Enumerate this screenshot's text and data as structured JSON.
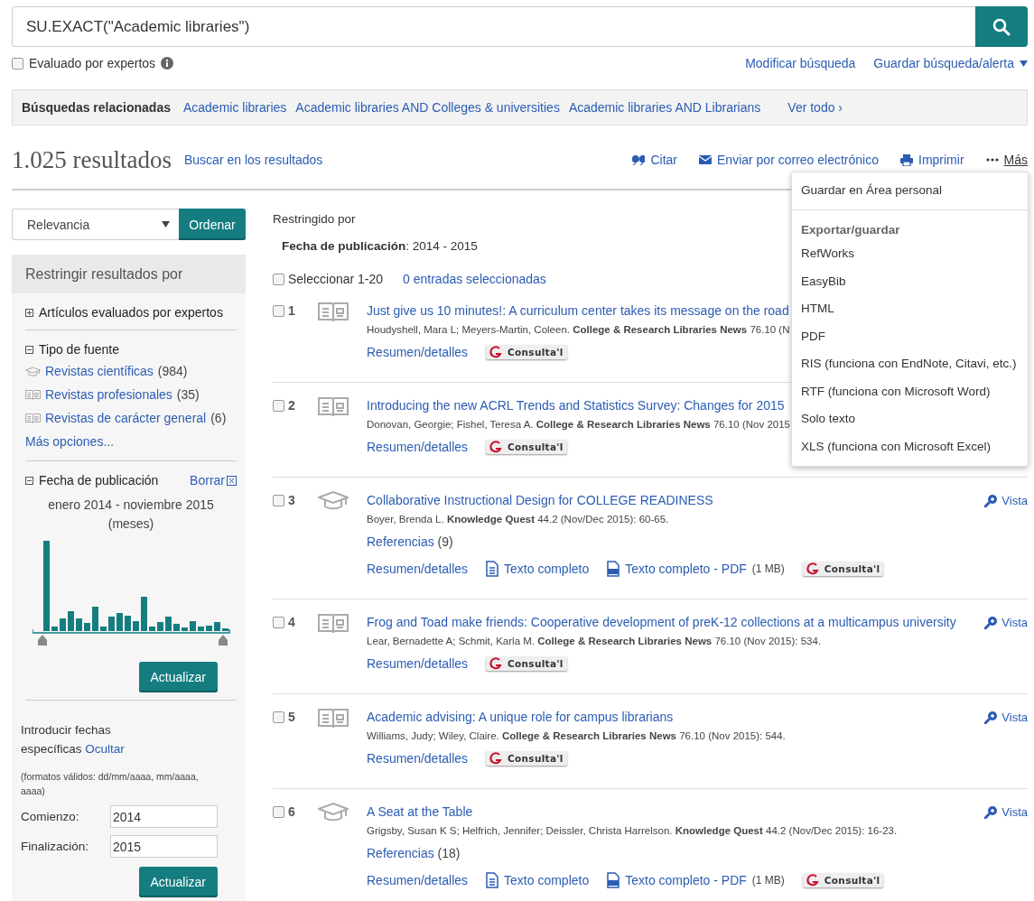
{
  "search": {
    "query": "SU.EXACT(\"Academic libraries\")",
    "peer_reviewed": {
      "label": "Evaluado por expertos",
      "checked": false
    },
    "links": [
      {
        "kind": "plain",
        "label": "Modificar búsqueda"
      },
      {
        "kind": "dropdown",
        "label": "Guardar búsqueda/alerta"
      }
    ]
  },
  "related": {
    "label": "Búsquedas relacionadas",
    "items": [
      "Academic libraries",
      "Academic libraries AND Colleges & universities",
      "Academic libraries AND Librarians"
    ],
    "see_all": "Ver todo ›"
  },
  "results_header": {
    "count": "1.025 resultados",
    "search_within": "Buscar en los resultados",
    "actions": [
      {
        "kind": "cite",
        "label": "Citar"
      },
      {
        "kind": "email",
        "label": "Enviar por correo electrónico"
      },
      {
        "kind": "print",
        "label": "Imprimir"
      },
      {
        "kind": "more",
        "label": "Más"
      }
    ]
  },
  "sort": {
    "value": "Relevancia",
    "button": "Ordenar"
  },
  "refine": {
    "title": "Restringir resultados por",
    "sections": [
      {
        "label": "Artículos evaluados por expertos",
        "expanded": false
      },
      {
        "label": "Tipo de fuente",
        "expanded": true,
        "items": [
          {
            "kind": "scholarly",
            "label": "Revistas científicas",
            "count": "(984)"
          },
          {
            "kind": "magazine",
            "label": "Revistas profesionales",
            "count": "(35)"
          },
          {
            "kind": "magazine",
            "label": "Revistas de carácter general",
            "count": "(6)"
          }
        ],
        "more": "Más opciones..."
      },
      {
        "label": "Fecha de publicación",
        "expanded": true,
        "clear": "Borrar"
      }
    ],
    "date_range": "enero 2014 - noviembre 2015",
    "unit": "(meses)",
    "update": "Actualizar",
    "specific": {
      "text": "Introducir fechas específicas",
      "toggle": "Ocultar",
      "formats": "(formatos válidos: dd/mm/aaaa, mm/aaaa, aaaa)",
      "fields": [
        {
          "label": "Comienzo:",
          "value": "2014"
        },
        {
          "label": "Finalización:",
          "value": "2015"
        }
      ],
      "update": "Actualizar"
    }
  },
  "limits": {
    "label": "Restringido por",
    "items": [
      "**Fecha de publicación**: 2014 - 2015"
    ]
  },
  "select": {
    "label": "Seleccionar 1-20",
    "checked": false,
    "selected_count": "0 entradas seleccionadas"
  },
  "results": [
    {
      "number": "1",
      "kind": "magazine",
      "checked": false,
      "title": "Just give us 10 minutes!: A curriculum center takes its message on the road",
      "citation": "Houdyshell, Mara L; Meyers-Martin, Coleen. **College & Research Libraries News** 76.10  (N",
      "links": [
        {
          "kind": "abstract",
          "label": "Resumen/detalles"
        },
        {
          "kind": "badge",
          "label": "Consulta'l"
        }
      ]
    },
    {
      "number": "2",
      "kind": "magazine",
      "checked": false,
      "title": "Introducing the new ACRL Trends and Statistics Survey: Changes for 2015",
      "citation": "Donovan, Georgie; Fishel, Teresa A. **College & Research Libraries News** 76.10  (Nov 2015",
      "links": [
        {
          "kind": "abstract",
          "label": "Resumen/detalles"
        },
        {
          "kind": "badge",
          "label": "Consulta'l"
        }
      ]
    },
    {
      "number": "3",
      "kind": "scholarly",
      "checked": false,
      "title": "Collaborative Instructional Design for COLLEGE READINESS",
      "citation": "Boyer, Brenda L. **Knowledge Quest** 44.2  (Nov/Dec 2015): 60-65.",
      "references": {
        "label": "Referencias",
        "count": "(9)"
      },
      "links": [
        {
          "kind": "abstract",
          "label": "Resumen/detalles"
        },
        {
          "kind": "fulltext",
          "label": "Texto completo"
        },
        {
          "kind": "pdf",
          "label": "Texto completo - PDF",
          "size": "(1 MB)"
        },
        {
          "kind": "badge",
          "label": "Consulta'l"
        }
      ],
      "preview": "Vista"
    },
    {
      "number": "4",
      "kind": "magazine",
      "checked": false,
      "title": "Frog and Toad make friends: Cooperative development of preK-12 collections at a multicampus university",
      "citation": "Lear, Bernadette A; Schmit, Karla M. **College & Research Libraries News** 76.10  (Nov 2015): 534.",
      "links": [
        {
          "kind": "abstract",
          "label": "Resumen/detalles"
        },
        {
          "kind": "badge",
          "label": "Consulta'l"
        }
      ],
      "preview": "Vista"
    },
    {
      "number": "5",
      "kind": "magazine",
      "checked": false,
      "title": "Academic advising: A unique role for campus librarians",
      "citation": "Williams, Judy; Wiley, Claire. **College & Research Libraries News** 76.10  (Nov 2015): 544.",
      "links": [
        {
          "kind": "abstract",
          "label": "Resumen/detalles"
        },
        {
          "kind": "badge",
          "label": "Consulta'l"
        }
      ],
      "preview": "Vista"
    },
    {
      "number": "6",
      "kind": "scholarly",
      "checked": false,
      "title": "A Seat at the Table",
      "citation": "Grigsby, Susan K S; Helfrich, Jennifer; Deissler, Christa Harrelson. **Knowledge Quest** 44.2  (Nov/Dec 2015): 16-23.",
      "references": {
        "label": "Referencias",
        "count": "(18)"
      },
      "links": [
        {
          "kind": "abstract",
          "label": "Resumen/detalles"
        },
        {
          "kind": "fulltext",
          "label": "Texto completo"
        },
        {
          "kind": "pdf",
          "label": "Texto completo - PDF",
          "size": "(1 MB)"
        },
        {
          "kind": "badge",
          "label": "Consulta'l"
        }
      ],
      "preview": "Vista"
    }
  ],
  "more_menu": {
    "top": "Guardar en Área personal",
    "heading": "Exportar/guardar",
    "items": [
      "RefWorks",
      "EasyBib",
      "HTML",
      "PDF",
      "RIS (funciona con EndNote, Citavi, etc.)",
      "RTF (funciona con Microsoft Word)",
      "Solo texto",
      "XLS (funciona con Microsoft Excel)"
    ]
  }
}
